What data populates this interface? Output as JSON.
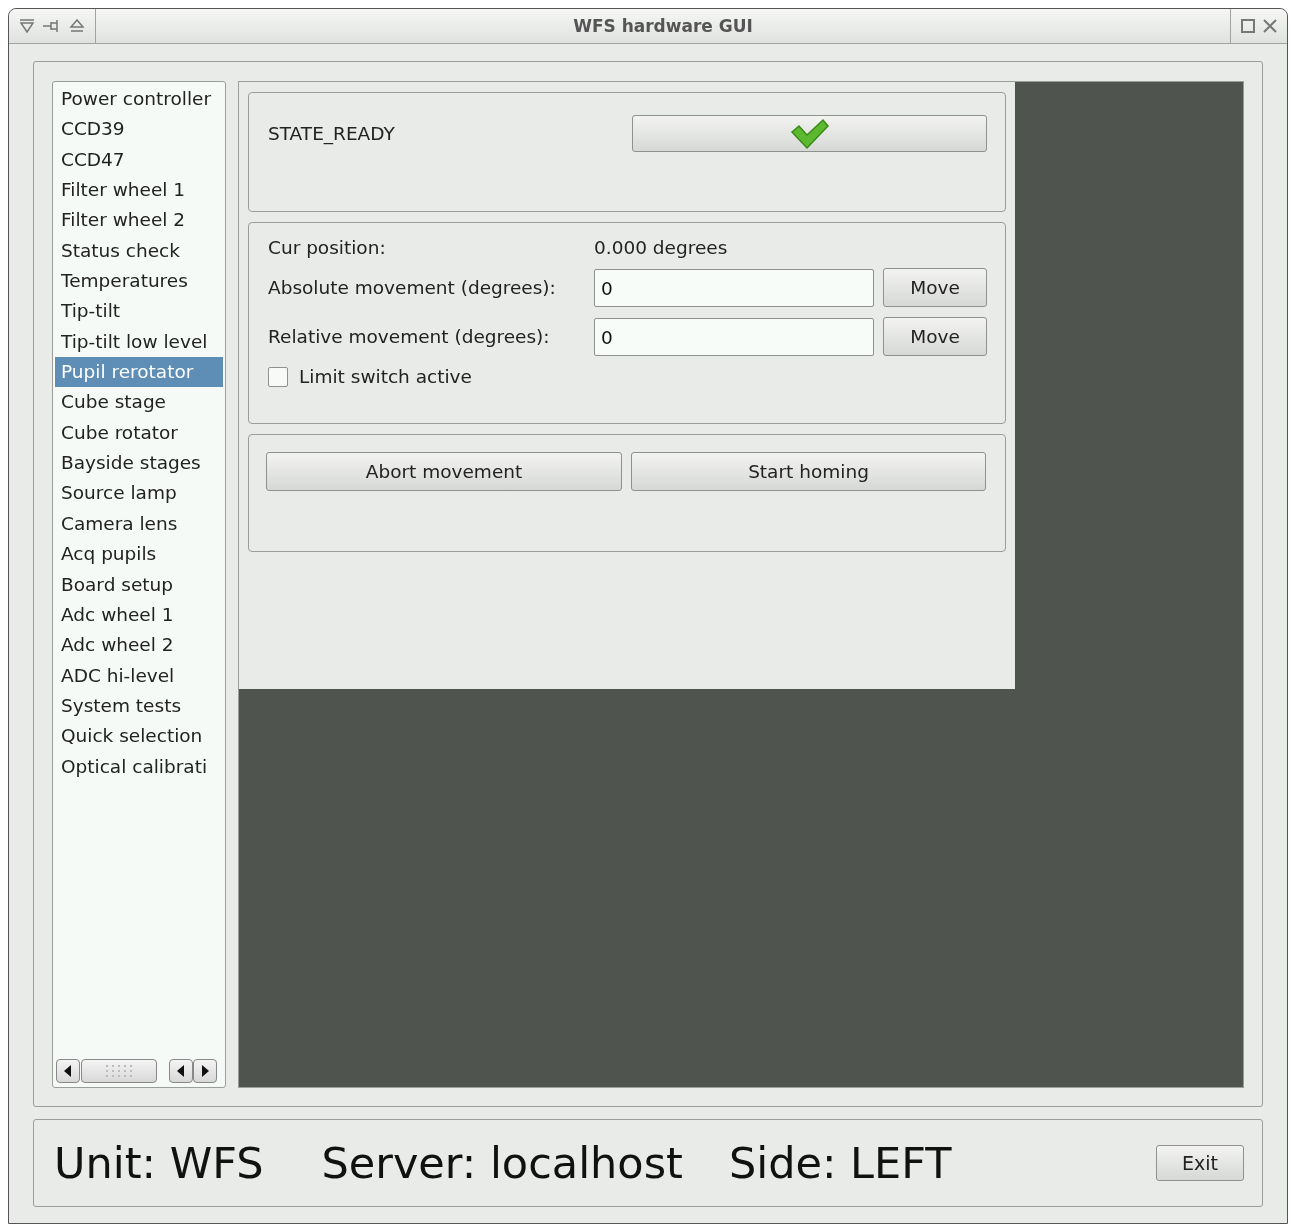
{
  "window": {
    "title": "WFS hardware GUI"
  },
  "sidebar": {
    "items": [
      {
        "label": "Power controller",
        "selected": false
      },
      {
        "label": "CCD39",
        "selected": false
      },
      {
        "label": "CCD47",
        "selected": false
      },
      {
        "label": "Filter wheel 1",
        "selected": false
      },
      {
        "label": "Filter wheel 2",
        "selected": false
      },
      {
        "label": "Status check",
        "selected": false
      },
      {
        "label": "Temperatures",
        "selected": false
      },
      {
        "label": "Tip-tilt",
        "selected": false
      },
      {
        "label": "Tip-tilt low level",
        "selected": false
      },
      {
        "label": "Pupil rerotator",
        "selected": true
      },
      {
        "label": "Cube stage",
        "selected": false
      },
      {
        "label": "Cube rotator",
        "selected": false
      },
      {
        "label": "Bayside stages",
        "selected": false
      },
      {
        "label": "Source lamp",
        "selected": false
      },
      {
        "label": "Camera lens",
        "selected": false
      },
      {
        "label": "Acq pupils",
        "selected": false
      },
      {
        "label": "Board setup",
        "selected": false
      },
      {
        "label": "Adc wheel 1",
        "selected": false
      },
      {
        "label": "Adc wheel 2",
        "selected": false
      },
      {
        "label": "ADC hi-level",
        "selected": false
      },
      {
        "label": "System tests",
        "selected": false
      },
      {
        "label": "Quick selection",
        "selected": false
      },
      {
        "label": "Optical calibrati",
        "selected": false
      }
    ]
  },
  "state": {
    "label": "STATE_READY"
  },
  "position": {
    "label": "Cur position:",
    "value": "0.000 degrees"
  },
  "movements": [
    {
      "label": "Absolute movement (degrees):",
      "value": "0",
      "button": "Move"
    },
    {
      "label": "Relative movement (degrees):",
      "value": "0",
      "button": "Move"
    }
  ],
  "limit_switch": {
    "label": "Limit switch active",
    "checked": false
  },
  "actions": [
    "Abort movement",
    "Start homing"
  ],
  "footer": {
    "unit": "Unit: WFS",
    "server": "Server: localhost",
    "side": "Side: LEFT",
    "exit": "Exit"
  }
}
